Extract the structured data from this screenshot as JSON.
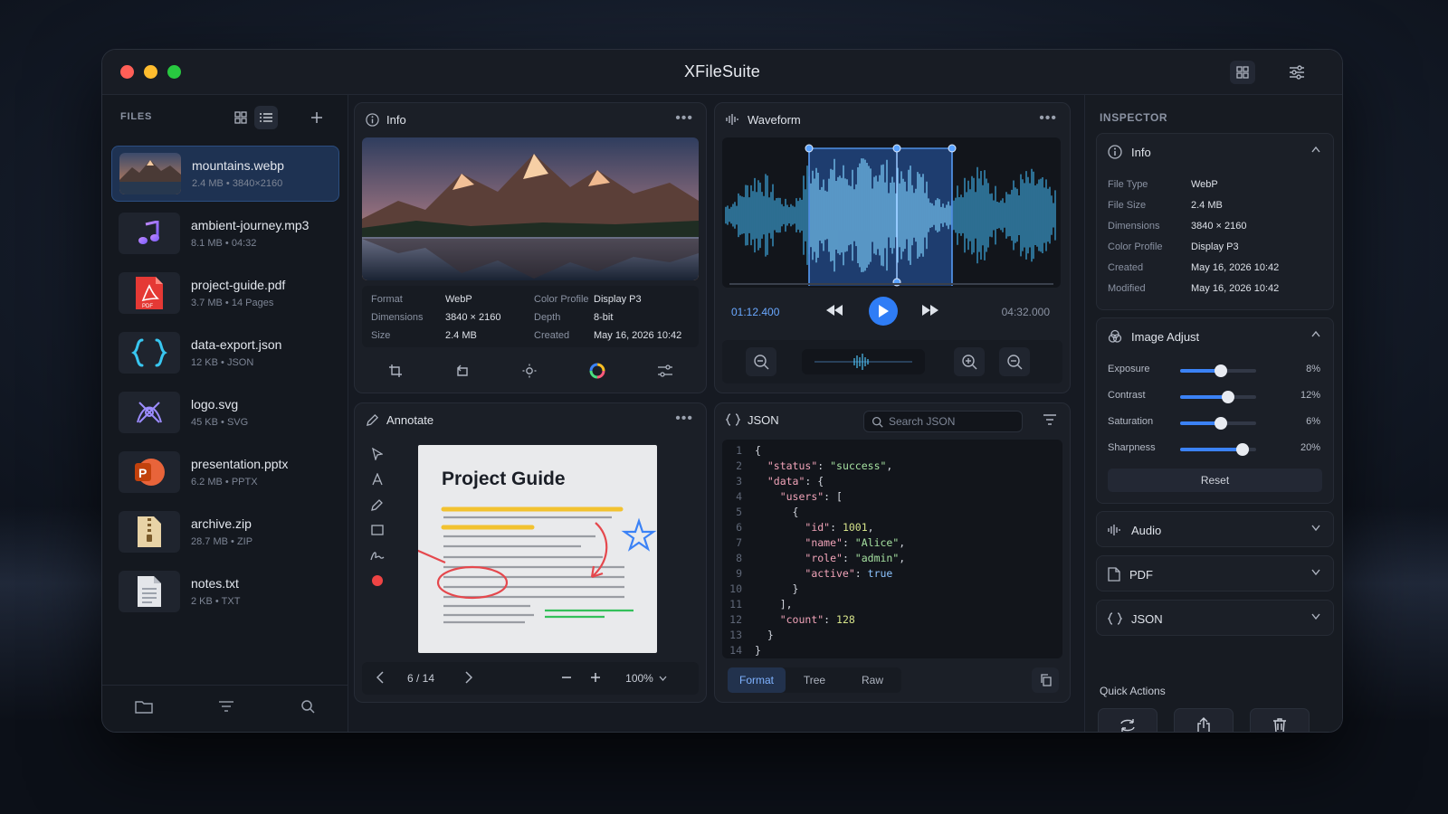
{
  "app": {
    "title": "XFileSuite"
  },
  "sidebar": {
    "title": "FILES",
    "files": [
      {
        "name": "mountains.webp",
        "size": "2.4 MB",
        "detail": "3840×2160",
        "icon": "image-thumbnail"
      },
      {
        "name": "ambient-journey.mp3",
        "size": "8.1 MB",
        "detail": "04:32",
        "icon": "music-note-icon"
      },
      {
        "name": "project-guide.pdf",
        "size": "3.7 MB",
        "detail": "14 Pages",
        "icon": "pdf-icon"
      },
      {
        "name": "data-export.json",
        "size": "12 KB",
        "detail": "JSON",
        "icon": "braces-icon"
      },
      {
        "name": "logo.svg",
        "size": "45 KB",
        "detail": "SVG",
        "icon": "vector-icon"
      },
      {
        "name": "presentation.pptx",
        "size": "6.2 MB",
        "detail": "PPTX",
        "icon": "powerpoint-icon"
      },
      {
        "name": "archive.zip",
        "size": "28.7 MB",
        "detail": "ZIP",
        "icon": "zip-icon"
      },
      {
        "name": "notes.txt",
        "size": "2 KB",
        "detail": "TXT",
        "icon": "text-file-icon"
      }
    ],
    "separator": "•",
    "pdf_badge": "PDF"
  },
  "info_panel": {
    "title": "Info",
    "rows": [
      {
        "k1": "Format",
        "v1": "WebP",
        "k2": "Color Profile",
        "v2": "Display P3"
      },
      {
        "k1": "Dimensions",
        "v1": "3840 × 2160",
        "k2": "Depth",
        "v2": "8-bit"
      },
      {
        "k1": "Size",
        "v1": "2.4 MB",
        "k2": "Created",
        "v2": "May 16, 2026 10:42"
      }
    ]
  },
  "waveform_panel": {
    "title": "Waveform",
    "current_time": "01:12.400",
    "total_time": "04:32.000"
  },
  "annotate_panel": {
    "title": "Annotate",
    "doc_title": "Project Guide",
    "page": "6 / 14",
    "zoom": "100%"
  },
  "json_panel": {
    "title": "JSON",
    "search_placeholder": "Search JSON",
    "lines": [
      "{",
      "  \"status\": \"success\",",
      "  \"data\": {",
      "    \"users\": [",
      "      {",
      "        \"id\": 1001,",
      "        \"name\": \"Alice\",",
      "        \"role\": \"admin\",",
      "        \"active\": true",
      "      }",
      "    ],",
      "    \"count\": 128",
      "  }",
      "}"
    ],
    "tabs": [
      "Format",
      "Tree",
      "Raw"
    ],
    "active_tab": "Format"
  },
  "inspector": {
    "title": "INSPECTOR",
    "info_card": {
      "label": "Info",
      "rows": [
        {
          "k": "File Type",
          "v": "WebP"
        },
        {
          "k": "File Size",
          "v": "2.4 MB"
        },
        {
          "k": "Dimensions",
          "v": "3840 × 2160"
        },
        {
          "k": "Color Profile",
          "v": "Display P3"
        },
        {
          "k": "Created",
          "v": "May 16, 2026 10:42"
        },
        {
          "k": "Modified",
          "v": "May 16, 2026 10:42"
        }
      ]
    },
    "image_adjust": {
      "label": "Image Adjust",
      "sliders": [
        {
          "name": "Exposure",
          "value": "8%",
          "level": 0.53
        },
        {
          "name": "Contrast",
          "value": "12%",
          "level": 0.63
        },
        {
          "name": "Saturation",
          "value": "6%",
          "level": 0.53
        },
        {
          "name": "Sharpness",
          "value": "20%",
          "level": 0.82
        }
      ],
      "reset_label": "Reset"
    },
    "sections": [
      "Audio",
      "PDF",
      "JSON"
    ],
    "quick_actions_title": "Quick Actions"
  },
  "colors": {
    "accent": "#3b82f6",
    "selected_bg": "#1e3252",
    "waveform": "#4fc3f7"
  }
}
